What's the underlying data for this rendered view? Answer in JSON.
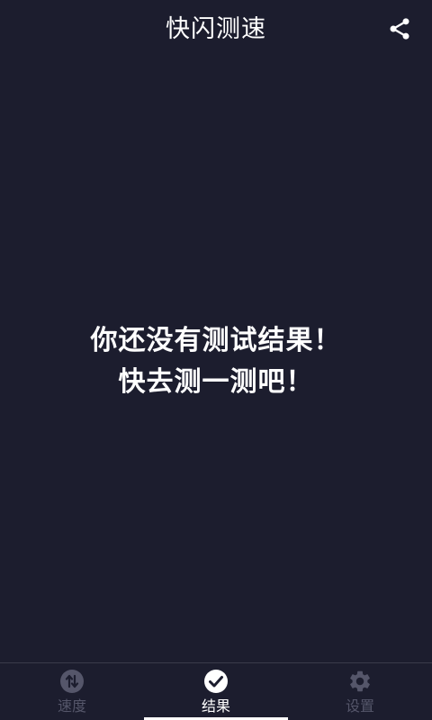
{
  "header": {
    "title": "快闪测速",
    "share_icon": "share-icon"
  },
  "empty_state": {
    "line1": "你还没有测试结果！",
    "line2": "快去测一测吧！"
  },
  "tabs": [
    {
      "label": "速度",
      "icon": "speed-arrows-icon",
      "active": false
    },
    {
      "label": "结果",
      "icon": "check-circle-icon",
      "active": true
    },
    {
      "label": "设置",
      "icon": "gear-icon",
      "active": false
    }
  ],
  "colors": {
    "background": "#1c1d2e",
    "text": "#ffffff",
    "inactive": "#55566a"
  }
}
